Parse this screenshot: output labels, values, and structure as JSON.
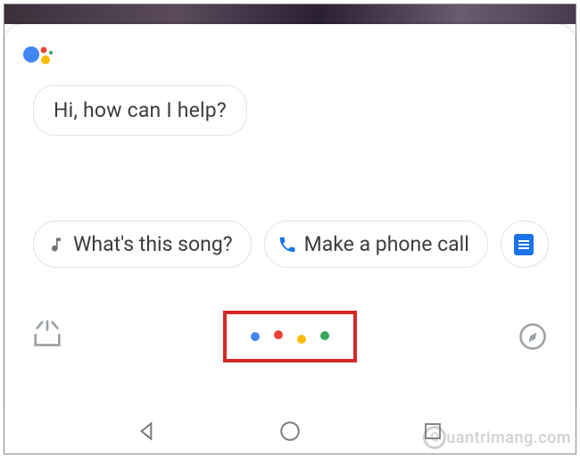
{
  "assistant": {
    "greeting": "Hi, how can I help?"
  },
  "suggestions": [
    {
      "icon": "music-note-icon",
      "label": "What's this song?"
    },
    {
      "icon": "phone-icon",
      "label": "Make a phone call"
    },
    {
      "icon": "message-icon",
      "label": ""
    }
  ],
  "colors": {
    "google_blue": "#4285F4",
    "google_red": "#EA4335",
    "google_yellow": "#FBBC05",
    "google_green": "#34A853",
    "highlight": "#d62828"
  },
  "watermark": "uantrimang.com"
}
